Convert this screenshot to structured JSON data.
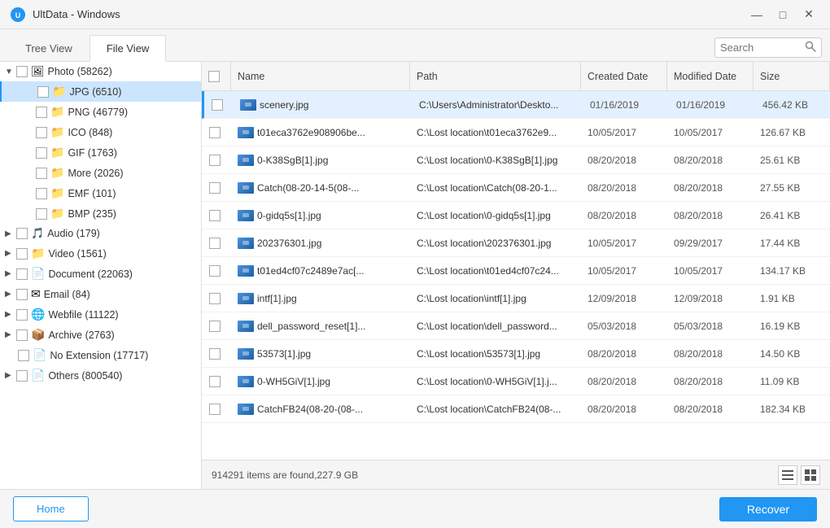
{
  "titleBar": {
    "title": "UltData - Windows",
    "controls": {
      "minimize": "—",
      "maximize": "□",
      "close": "✕"
    }
  },
  "tabs": {
    "treeView": "Tree View",
    "fileView": "File View",
    "activeTab": "fileView"
  },
  "search": {
    "placeholder": "Search",
    "icon": "🔍"
  },
  "sidebar": {
    "items": [
      {
        "label": "Photo (58262)",
        "indent": 0,
        "hasArrow": true,
        "expanded": true,
        "icon": "🖼",
        "type": "photo"
      },
      {
        "label": "JPG (6510)",
        "indent": 1,
        "hasArrow": false,
        "selected": true,
        "icon": "📁",
        "type": "folder"
      },
      {
        "label": "PNG (46779)",
        "indent": 1,
        "hasArrow": false,
        "icon": "📁",
        "type": "folder"
      },
      {
        "label": "ICO (848)",
        "indent": 1,
        "hasArrow": false,
        "icon": "📁",
        "type": "folder"
      },
      {
        "label": "GIF (1763)",
        "indent": 1,
        "hasArrow": false,
        "icon": "📁",
        "type": "folder"
      },
      {
        "label": "More (2026)",
        "indent": 1,
        "hasArrow": false,
        "icon": "📁",
        "type": "folder"
      },
      {
        "label": "EMF (101)",
        "indent": 1,
        "hasArrow": false,
        "icon": "📁",
        "type": "folder"
      },
      {
        "label": "BMP (235)",
        "indent": 1,
        "hasArrow": false,
        "icon": "📁",
        "type": "folder"
      },
      {
        "label": "Audio (179)",
        "indent": 0,
        "hasArrow": true,
        "icon": "🎵",
        "type": "audio"
      },
      {
        "label": "Video (1561)",
        "indent": 0,
        "hasArrow": true,
        "icon": "📁",
        "type": "video"
      },
      {
        "label": "Document (22063)",
        "indent": 0,
        "hasArrow": true,
        "icon": "📄",
        "type": "document"
      },
      {
        "label": "Email (84)",
        "indent": 0,
        "hasArrow": true,
        "icon": "✉",
        "type": "email"
      },
      {
        "label": "Webfile (11122)",
        "indent": 0,
        "hasArrow": true,
        "icon": "🌐",
        "type": "webfile"
      },
      {
        "label": "Archive (2763)",
        "indent": 0,
        "hasArrow": true,
        "icon": "📦",
        "type": "archive"
      },
      {
        "label": "No Extension (17717)",
        "indent": 0,
        "hasArrow": false,
        "icon": "📄",
        "type": "noext"
      },
      {
        "label": "Others (800540)",
        "indent": 0,
        "hasArrow": true,
        "icon": "📄",
        "type": "others"
      }
    ]
  },
  "fileTable": {
    "columns": [
      "Name",
      "Path",
      "Created Date",
      "Modified Date",
      "Size"
    ],
    "rows": [
      {
        "name": "scenery.jpg",
        "path": "C:\\Users\\Administrator\\Deskto...",
        "created": "01/16/2019",
        "modified": "01/16/2019",
        "size": "456.42 KB",
        "selected": true
      },
      {
        "name": "t01eca3762e908906be...",
        "path": "C:\\Lost location\\t01eca3762e9...",
        "created": "10/05/2017",
        "modified": "10/05/2017",
        "size": "126.67 KB",
        "selected": false
      },
      {
        "name": "0-K38SgB[1].jpg",
        "path": "C:\\Lost location\\0-K38SgB[1].jpg",
        "created": "08/20/2018",
        "modified": "08/20/2018",
        "size": "25.61 KB",
        "selected": false
      },
      {
        "name": "Catch(08-20-14-5(08-...",
        "path": "C:\\Lost location\\Catch(08-20-1...",
        "created": "08/20/2018",
        "modified": "08/20/2018",
        "size": "27.55 KB",
        "selected": false
      },
      {
        "name": "0-gidq5s[1].jpg",
        "path": "C:\\Lost location\\0-gidq5s[1].jpg",
        "created": "08/20/2018",
        "modified": "08/20/2018",
        "size": "26.41 KB",
        "selected": false
      },
      {
        "name": "202376301.jpg",
        "path": "C:\\Lost location\\202376301.jpg",
        "created": "10/05/2017",
        "modified": "09/29/2017",
        "size": "17.44 KB",
        "selected": false
      },
      {
        "name": "t01ed4cf07c2489e7ac[...",
        "path": "C:\\Lost location\\t01ed4cf07c24...",
        "created": "10/05/2017",
        "modified": "10/05/2017",
        "size": "134.17 KB",
        "selected": false
      },
      {
        "name": "intf[1].jpg",
        "path": "C:\\Lost location\\intf[1].jpg",
        "created": "12/09/2018",
        "modified": "12/09/2018",
        "size": "1.91 KB",
        "selected": false
      },
      {
        "name": "dell_password_reset[1]...",
        "path": "C:\\Lost location\\dell_password...",
        "created": "05/03/2018",
        "modified": "05/03/2018",
        "size": "16.19 KB",
        "selected": false
      },
      {
        "name": "53573[1].jpg",
        "path": "C:\\Lost location\\53573[1].jpg",
        "created": "08/20/2018",
        "modified": "08/20/2018",
        "size": "14.50 KB",
        "selected": false
      },
      {
        "name": "0-WH5GiV[1].jpg",
        "path": "C:\\Lost location\\0-WH5GiV[1].j...",
        "created": "08/20/2018",
        "modified": "08/20/2018",
        "size": "11.09 KB",
        "selected": false
      },
      {
        "name": "CatchFB24(08-20-(08-...",
        "path": "C:\\Lost location\\CatchFB24(08-...",
        "created": "08/20/2018",
        "modified": "08/20/2018",
        "size": "182.34 KB",
        "selected": false
      }
    ]
  },
  "statusBar": {
    "text": "914291 items are found,227.9 GB"
  },
  "bottomBar": {
    "homeLabel": "Home",
    "recoverLabel": "Recover"
  }
}
